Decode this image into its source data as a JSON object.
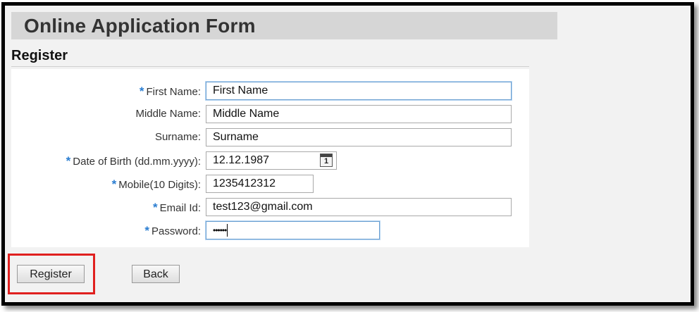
{
  "header": {
    "title": "Online Application Form"
  },
  "section": {
    "title": "Register"
  },
  "form": {
    "required_marker": "*",
    "first_name": {
      "label": "First Name:",
      "value": "First Name"
    },
    "middle_name": {
      "label": "Middle Name:",
      "value": "Middle Name"
    },
    "surname": {
      "label": "Surname:",
      "value": "Surname"
    },
    "dob": {
      "label": "Date of Birth (dd.mm.yyyy):",
      "value": "12.12.1987",
      "calendar_icon_text": "1"
    },
    "mobile": {
      "label": "Mobile(10 Digits):",
      "value": "1235412312"
    },
    "email": {
      "label": "Email Id:",
      "value": "test123@gmail.com"
    },
    "password": {
      "label": "Password:",
      "value": "••••••"
    }
  },
  "actions": {
    "register_label": "Register",
    "back_label": "Back"
  },
  "colors": {
    "required": "#2a7dd1",
    "highlight": "#e0201f",
    "title_bar": "#d6d6d6"
  },
  "icons": {
    "calendar": "calendar-icon"
  }
}
